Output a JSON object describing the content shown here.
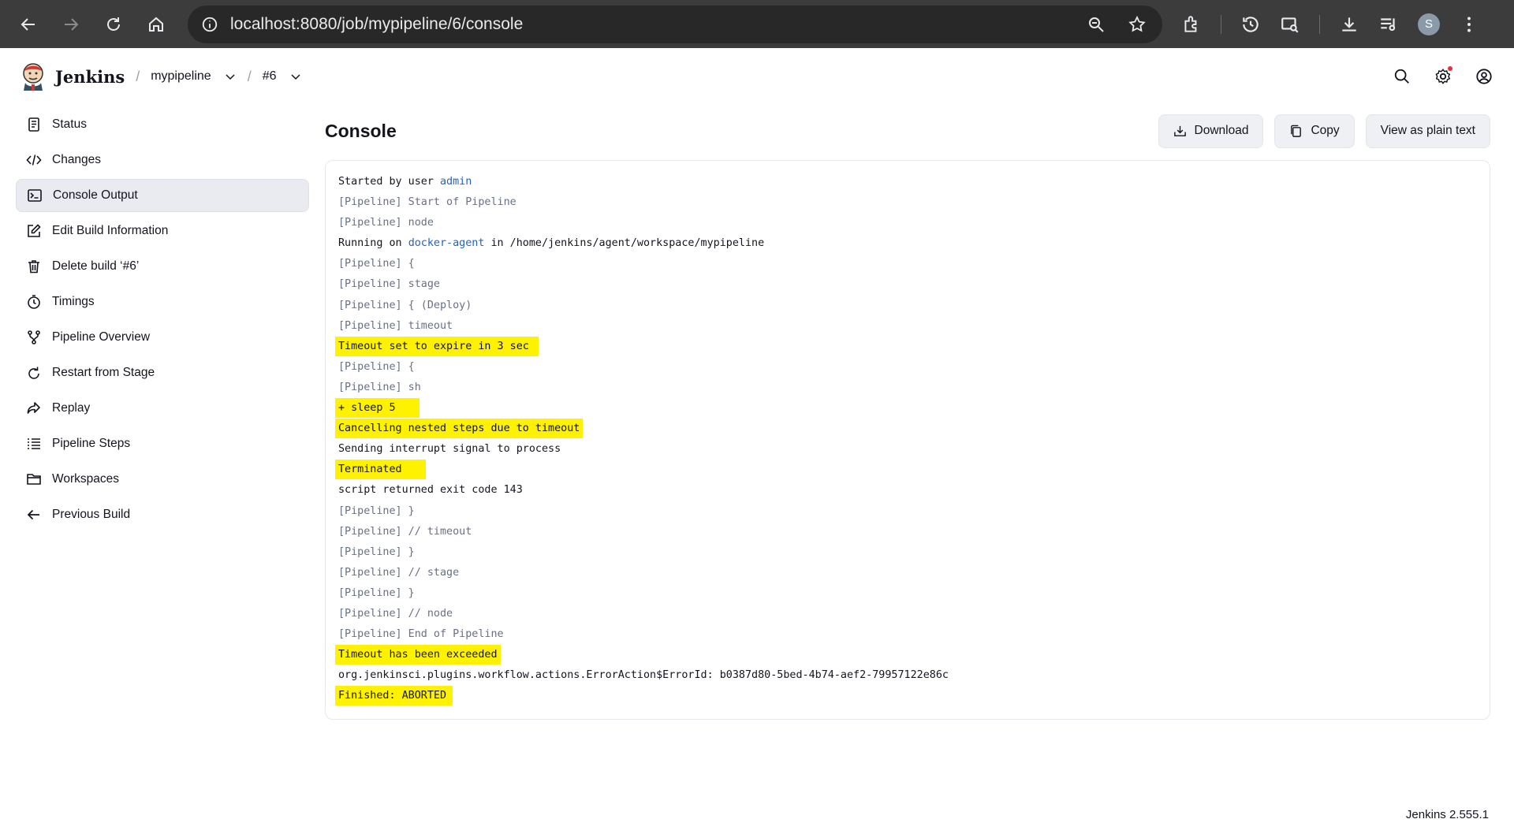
{
  "browser": {
    "url": "localhost:8080/job/mypipeline/6/console",
    "profile_initial": "S"
  },
  "header": {
    "title": "Jenkins",
    "breadcrumbs": [
      "mypipeline",
      "#6"
    ]
  },
  "sidebar": {
    "items": [
      {
        "label": "Status",
        "icon": "document-icon"
      },
      {
        "label": "Changes",
        "icon": "code-icon"
      },
      {
        "label": "Console Output",
        "icon": "terminal-icon",
        "active": true
      },
      {
        "label": "Edit Build Information",
        "icon": "edit-icon"
      },
      {
        "label": "Delete build ‘#6’",
        "icon": "trash-icon"
      },
      {
        "label": "Timings",
        "icon": "stopwatch-icon"
      },
      {
        "label": "Pipeline Overview",
        "icon": "branch-icon"
      },
      {
        "label": "Restart from Stage",
        "icon": "restart-icon"
      },
      {
        "label": "Replay",
        "icon": "replay-icon"
      },
      {
        "label": "Pipeline Steps",
        "icon": "list-icon"
      },
      {
        "label": "Workspaces",
        "icon": "folder-icon"
      },
      {
        "label": "Previous Build",
        "icon": "arrow-left-icon"
      }
    ]
  },
  "main": {
    "title": "Console",
    "actions": {
      "download": "Download",
      "copy": "Copy",
      "plain": "View as plain text"
    },
    "console": {
      "started_prefix": "Started by user ",
      "started_user": "admin",
      "running_prefix": "Running on ",
      "running_agent": "docker-agent",
      "running_suffix": " in /home/jenkins/agent/workspace/mypipeline",
      "pipeline_tag": "[Pipeline]",
      "lines": {
        "l2": " Start of Pipeline",
        "l3": " node",
        "l5": " {",
        "l6": " stage",
        "l7": " { (Deploy)",
        "l8": " timeout",
        "l9": "Timeout set to expire in 3 sec",
        "l10": " {",
        "l11": " sh",
        "l12": "+ sleep 5",
        "l13": "Cancelling nested steps due to timeout",
        "l14": "Sending interrupt signal to process",
        "l15": "Terminated",
        "l16": "script returned exit code 143",
        "l17": " }",
        "l18": " // timeout",
        "l19": " }",
        "l20": " // stage",
        "l21": " }",
        "l22": " // node",
        "l23": " End of Pipeline",
        "l24": "Timeout has been exceeded",
        "l25": "org.jenkinsci.plugins.workflow.actions.ErrorAction$ErrorId: b0387d80-5bed-4b74-aef2-79957122e86c",
        "l26": "Finished: ABORTED"
      }
    }
  },
  "footer": {
    "version": "Jenkins 2.555.1"
  },
  "colors": {
    "highlight": "#fff200",
    "link": "#2462c7",
    "pipeline_tag": "#67708a",
    "active_nav_bg": "#e9ebf1"
  }
}
